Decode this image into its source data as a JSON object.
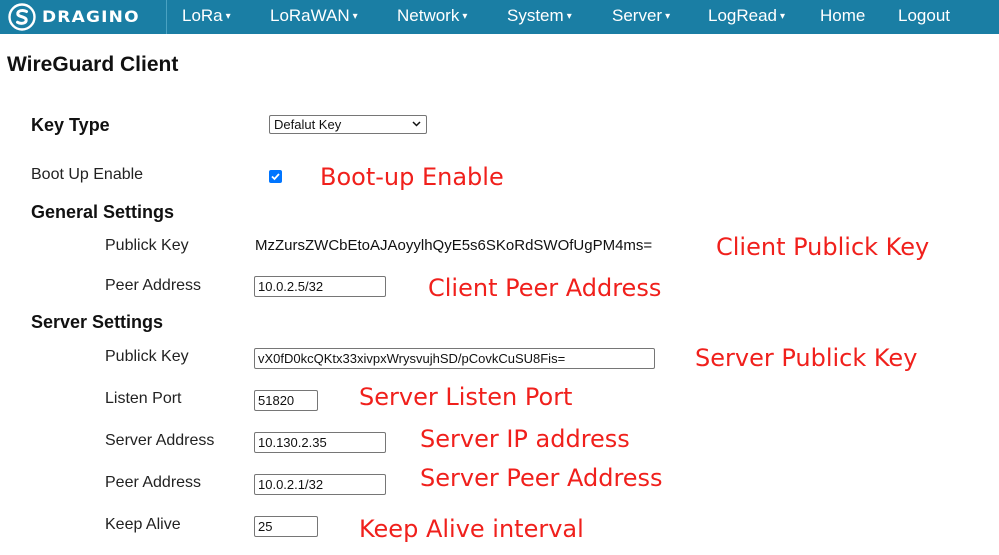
{
  "nav": {
    "logo_text": "DRAGINO",
    "items": [
      {
        "label": "LoRa",
        "dropdown": true
      },
      {
        "label": "LoRaWAN",
        "dropdown": true
      },
      {
        "label": "Network",
        "dropdown": true
      },
      {
        "label": "System",
        "dropdown": true
      },
      {
        "label": "Server",
        "dropdown": true
      },
      {
        "label": "LogRead",
        "dropdown": true
      },
      {
        "label": "Home",
        "dropdown": false
      },
      {
        "label": "Logout",
        "dropdown": false
      }
    ],
    "caret": "▾"
  },
  "page": {
    "title": "WireGuard Client"
  },
  "key_type": {
    "label": "Key Type",
    "selected": "Defalut Key"
  },
  "boot_up": {
    "label": "Boot Up Enable",
    "checked": true
  },
  "general": {
    "title": "General Settings",
    "publick_key_label": "Publick Key",
    "publick_key_value": "MzZursZWCbEtoAJAoyylhQyE5s6SKoRdSWOfUgPM4ms=",
    "peer_address_label": "Peer Address",
    "peer_address_value": "10.0.2.5/32"
  },
  "server": {
    "title": "Server Settings",
    "publick_key_label": "Publick Key",
    "publick_key_value": "vX0fD0kcQKtx33xivpxWrysvujhSD/pCovkCuSU8Fis=",
    "listen_port_label": "Listen Port",
    "listen_port_value": "51820",
    "server_address_label": "Server Address",
    "server_address_value": "10.130.2.35",
    "peer_address_label": "Peer Address",
    "peer_address_value": "10.0.2.1/32",
    "keep_alive_label": "Keep Alive",
    "keep_alive_value": "25"
  },
  "annotations": {
    "boot_up": "Boot-up Enable",
    "client_key": "Client Publick Key",
    "client_peer": "Client Peer Address",
    "server_key": "Server Publick Key",
    "server_port": "Server Listen Port",
    "server_ip": "Server IP address",
    "server_peer": "Server Peer Address",
    "keep_alive": "Keep Alive interval"
  },
  "colors": {
    "nav_bg": "#1a7ea4",
    "annotation": "#f0201c",
    "checkbox": "#0075ff"
  },
  "icons": {
    "logo": "dragino-logo-icon",
    "checkbox": "checkmark-icon",
    "select": "chevron-down-icon"
  }
}
